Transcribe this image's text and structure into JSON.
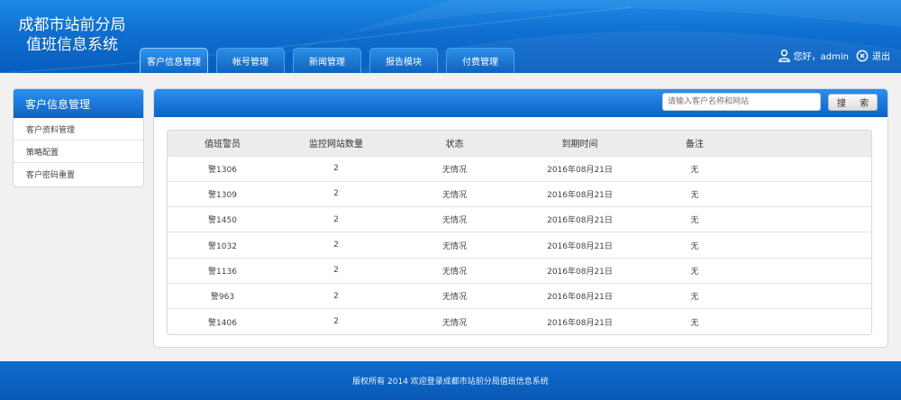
{
  "app": {
    "title_line1": "成都市站前分局",
    "title_line2": "值班信息系统"
  },
  "nav": {
    "tabs": [
      {
        "label": "客户信息管理",
        "active": true
      },
      {
        "label": "帐号管理",
        "active": false
      },
      {
        "label": "新闻管理",
        "active": false
      },
      {
        "label": "报告模块",
        "active": false
      },
      {
        "label": "付费管理",
        "active": false
      }
    ]
  },
  "user": {
    "greeting": "您好，admin",
    "logout_label": "退出",
    "user_icon": "user-icon",
    "logout_icon": "close-circle-icon"
  },
  "sidebar": {
    "title": "客户信息管理",
    "items": [
      {
        "label": "客户资料管理"
      },
      {
        "label": "策略配置"
      },
      {
        "label": "客户密码重置"
      }
    ]
  },
  "search": {
    "placeholder": "请输入客户名称和网站",
    "button_label": "搜 索"
  },
  "table": {
    "headers": [
      "值班警员",
      "监控网站数量",
      "状态",
      "到期时间",
      "备注"
    ],
    "rows": [
      [
        "警1306",
        "2",
        "无情况",
        "2016年08月21日",
        "无"
      ],
      [
        "警1309",
        "2",
        "无情况",
        "2016年08月21日",
        "无"
      ],
      [
        "警1450",
        "2",
        "无情况",
        "2016年08月21日",
        "无"
      ],
      [
        "警1032",
        "2",
        "无情况",
        "2016年08月21日",
        "无"
      ],
      [
        "警1136",
        "2",
        "无情况",
        "2016年08月21日",
        "无"
      ],
      [
        "警963",
        "2",
        "无情况",
        "2016年08月21日",
        "无"
      ],
      [
        "警1406",
        "2",
        "无情况",
        "2016年08月21日",
        "无"
      ]
    ]
  },
  "footer": {
    "text": "版权所有 2014 欢迎登录成都市站前分局值班信息系统"
  },
  "colors": {
    "header_blue": "#0f6fd0",
    "panel_bar_blue": "#1a7ce0",
    "footer_blue": "#0a5ab6",
    "background": "#f1f1f1"
  }
}
